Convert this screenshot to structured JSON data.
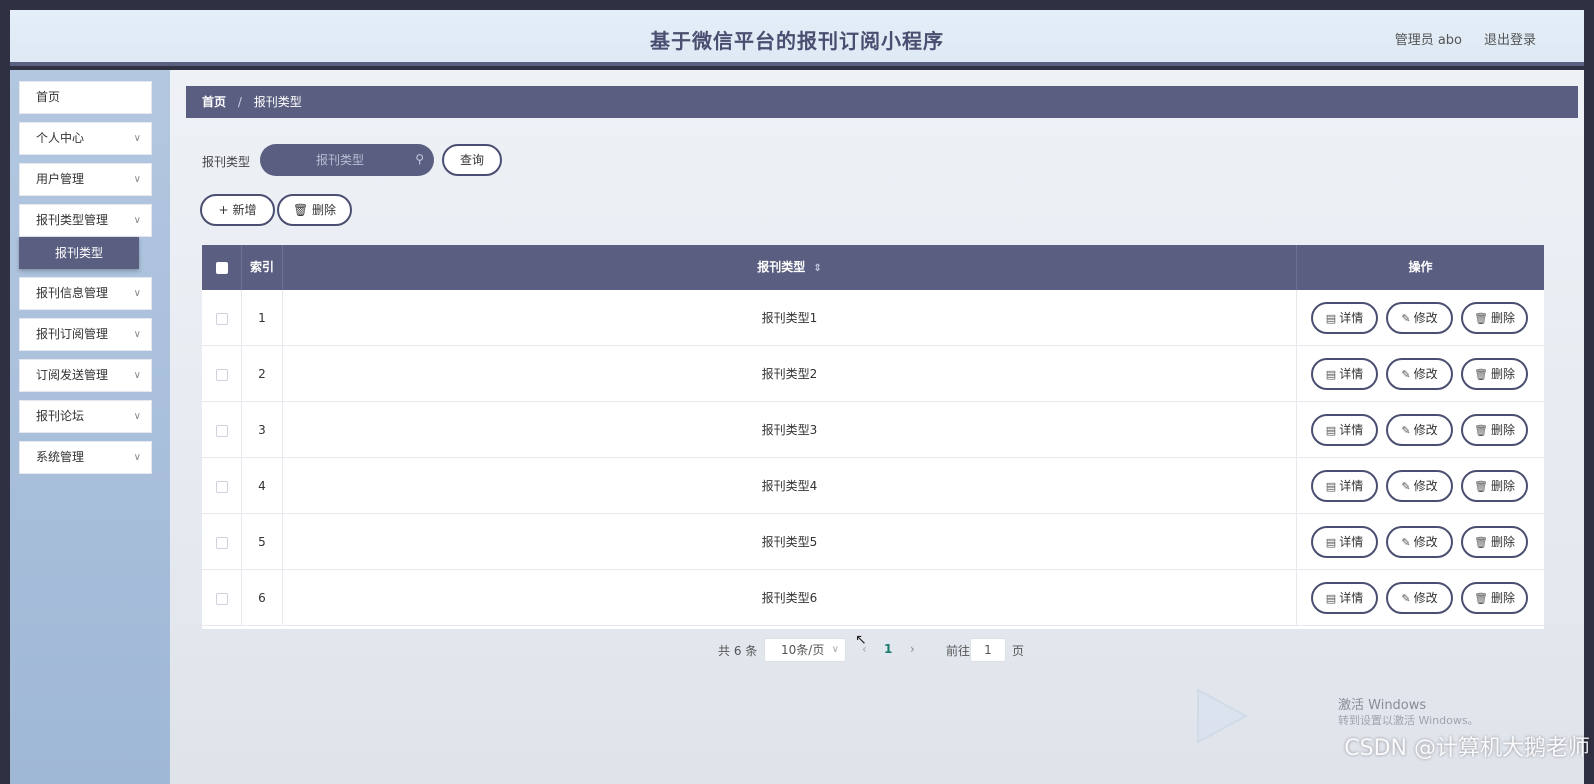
{
  "header": {
    "title": "基于微信平台的报刊订阅小程序",
    "user_label": "管理员 abo",
    "logout_label": "退出登录"
  },
  "sidebar": {
    "items": [
      {
        "label": "首页",
        "has_chevron": false
      },
      {
        "label": "个人中心",
        "has_chevron": true
      },
      {
        "label": "用户管理",
        "has_chevron": true
      },
      {
        "label": "报刊类型管理",
        "has_chevron": true
      },
      {
        "label": "报刊信息管理",
        "has_chevron": true
      },
      {
        "label": "报刊订阅管理",
        "has_chevron": true
      },
      {
        "label": "订阅发送管理",
        "has_chevron": true
      },
      {
        "label": "报刊论坛",
        "has_chevron": true
      },
      {
        "label": "系统管理",
        "has_chevron": true
      }
    ],
    "active_sub_item": "报刊类型"
  },
  "breadcrumb": {
    "home": "首页",
    "separator": "/",
    "current": "报刊类型"
  },
  "search": {
    "label": "报刊类型",
    "placeholder": "报刊类型",
    "button_label": "查询"
  },
  "toolbar": {
    "add_label": "新增",
    "delete_label": "删除"
  },
  "table": {
    "columns": [
      "索引",
      "报刊类型",
      "操作"
    ],
    "sort_glyph": "⇕",
    "rows": [
      {
        "index": "1",
        "type": "报刊类型1"
      },
      {
        "index": "2",
        "type": "报刊类型2"
      },
      {
        "index": "3",
        "type": "报刊类型3"
      },
      {
        "index": "4",
        "type": "报刊类型4"
      },
      {
        "index": "5",
        "type": "报刊类型5"
      },
      {
        "index": "6",
        "type": "报刊类型6"
      }
    ],
    "actions": {
      "detail_label": "详情",
      "edit_label": "修改",
      "delete_label": "删除"
    }
  },
  "pagination": {
    "total_text": "共 6 条",
    "page_size": "10条/页",
    "current_page": "1",
    "goto_label": "前往",
    "goto_value": "1",
    "page_unit": "页"
  },
  "watermarks": {
    "activate_text": "激活 Windows",
    "activate_sub": "转到设置以激活 Windows。",
    "csdn_text": "CSDN @计算机大鹅老师"
  },
  "colors": {
    "accent": "#5a5e80",
    "header_bg": "#e4eef8",
    "sidebar_bg": "#a9c0dc",
    "page_link": "#1a7a6d"
  }
}
